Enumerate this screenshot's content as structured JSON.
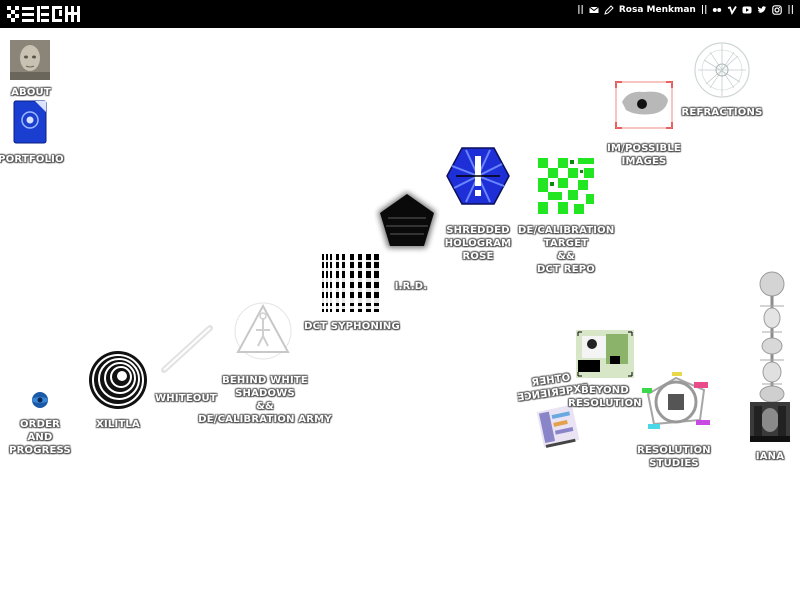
{
  "header": {
    "separator_left": "||",
    "author": "Rosa Menkman",
    "separator_mid": "||",
    "separator_right": "||",
    "social_icons": [
      "mail-icon",
      "pencil-icon",
      "flickr-icon",
      "vimeo-icon",
      "youtube-icon",
      "twitter-icon",
      "instagram-icon"
    ]
  },
  "desktop": {
    "about": "ABOUT",
    "portfolio": "PORTFOLIO",
    "refractions": "REFRACTIONS",
    "impossible_images": "IM/POSSIBLE\nIMAGES",
    "shredded_hologram_rose": "SHREDDED\nHOLOGRAM\nROSE",
    "decalibration_target": "DE/CALIBRATION\nTARGET\n&&\nDCT REPO",
    "ird": "I.R.D.",
    "dct_syphoning": "DCT SYPHONING",
    "behind_white_shadows": "BEHIND WHITE\nSHADOWS\n&&\nDE/CALIBRATION ARMY",
    "whiteout": "WHITEOUT",
    "xilitla": "XILITLA",
    "order_and_progress": "ORDER\nAND\nPROGRESS",
    "beyond_resolution": "BEYOND\nRESOLUTION",
    "mirrored_text": "ЯƎHTO\nƎƆИƎIЯƎPXƎ",
    "resolution_studies": "RESOLUTION\nSTUDIES",
    "iana": "IANA"
  }
}
